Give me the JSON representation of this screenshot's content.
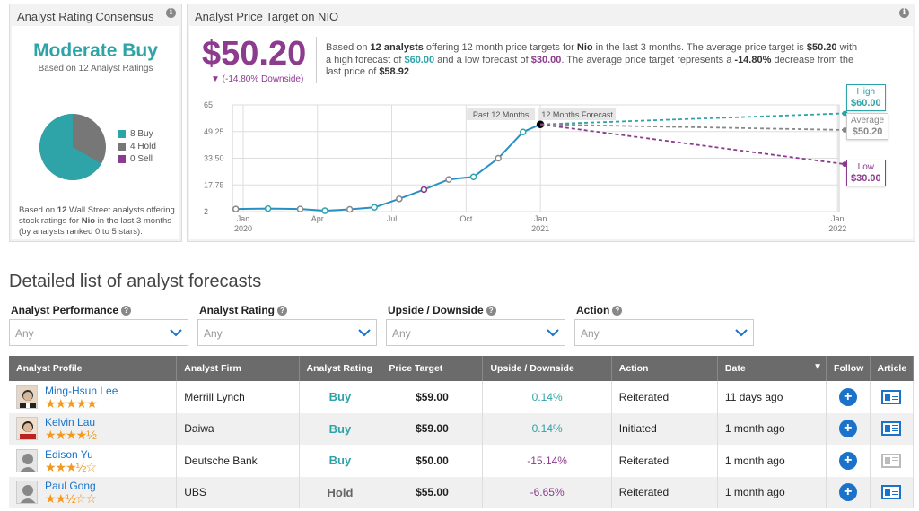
{
  "consensus": {
    "panel_title": "Analyst Rating Consensus",
    "rating": "Moderate Buy",
    "subtitle": "Based on 12 Analyst Ratings",
    "legend": [
      {
        "label": "8 Buy",
        "color": "#2ea3a8",
        "count": 8
      },
      {
        "label": "4 Hold",
        "color": "#777777",
        "count": 4
      },
      {
        "label": "0 Sell",
        "color": "#8c3b8e",
        "count": 0
      }
    ],
    "footer_pre": "Based on ",
    "footer_count": "12",
    "footer_mid": " Wall Street analysts offering stock ratings for ",
    "footer_ticker": "Nio",
    "footer_post": " in the last 3 months (by analysts ranked 0 to 5 stars)."
  },
  "price_target": {
    "panel_title": "Analyst Price Target on NIO",
    "price": "$50.20",
    "downside": "▼ (-14.80% Downside)",
    "desc": {
      "p1": "Based on ",
      "analysts": "12 analysts",
      "p2": " offering 12 month price targets for ",
      "ticker": "Nio",
      "p3": " in the last 3 months. The average price target is ",
      "avg": "$50.20",
      "p4": " with a high forecast of ",
      "high": "$60.00",
      "p5": " and a low forecast of ",
      "low": "$30.00",
      "p6": ". The average price target represents a ",
      "pct": "-14.80%",
      "p7": " decrease from the last price of ",
      "last": "$58.92"
    },
    "tags": {
      "high_label": "High",
      "high_value": "$60.00",
      "avg_label": "Average",
      "avg_value": "$50.20",
      "low_label": "Low",
      "low_value": "$30.00"
    },
    "past_label": "Past 12 Months",
    "forecast_label": "12 Months Forecast"
  },
  "chart_data": {
    "type": "line",
    "ylim": [
      2,
      65
    ],
    "y_ticks": [
      "65",
      "49.25",
      "33.50",
      "17.75",
      "2"
    ],
    "x_ticks": [
      {
        "label": "Jan",
        "sub": "2020",
        "m": 0
      },
      {
        "label": "Apr",
        "sub": "",
        "m": 3
      },
      {
        "label": "Jul",
        "sub": "",
        "m": 6
      },
      {
        "label": "Oct",
        "sub": "",
        "m": 9
      },
      {
        "label": "Jan",
        "sub": "2021",
        "m": 12
      },
      {
        "label": "Jan",
        "sub": "2022",
        "m": 24
      }
    ],
    "series": [
      {
        "m": [
          -0.3,
          1,
          2.3,
          3.3,
          4.3,
          5.3,
          6.3,
          7.3,
          8.3,
          9.3,
          10.3,
          11.3,
          12
        ],
        "values": [
          3.5,
          3.8,
          3.5,
          2.5,
          3.3,
          4.5,
          9.5,
          15,
          21,
          22.5,
          33.5,
          49,
          53.5
        ]
      }
    ],
    "forecast": {
      "start": 53.5,
      "high": 60.0,
      "avg": 50.2,
      "low": 30.0,
      "colors": {
        "high": "#2ea3a8",
        "avg": "#888888",
        "low": "#8c3b8e"
      }
    }
  },
  "list": {
    "title": "Detailed list of analyst forecasts",
    "filters": [
      {
        "label": "Analyst Performance",
        "value": "Any"
      },
      {
        "label": "Analyst Rating",
        "value": "Any"
      },
      {
        "label": "Upside / Downside",
        "value": "Any"
      },
      {
        "label": "Action",
        "value": "Any"
      }
    ],
    "columns": [
      "Analyst Profile",
      "Analyst Firm",
      "Analyst Rating",
      "Price Target",
      "Upside / Downside",
      "Action",
      "Date",
      "Follow",
      "Article"
    ],
    "rows": [
      {
        "name": "Ming-Hsun Lee",
        "stars": "★★★★★",
        "firm": "Merrill Lynch",
        "rating": "Buy",
        "target": "$59.00",
        "pct": "0.14%",
        "action": "Reiterated",
        "date": "11 days ago"
      },
      {
        "name": "Kelvin Lau",
        "stars": "★★★★½",
        "firm": "Daiwa",
        "rating": "Buy",
        "target": "$59.00",
        "pct": "0.14%",
        "action": "Initiated",
        "date": "1 month ago"
      },
      {
        "name": "Edison Yu",
        "stars": "★★★½☆",
        "firm": "Deutsche Bank",
        "rating": "Buy",
        "target": "$50.00",
        "pct": "-15.14%",
        "action": "Reiterated",
        "date": "1 month ago"
      },
      {
        "name": "Paul Gong",
        "stars": "★★½☆☆",
        "firm": "UBS",
        "rating": "Hold",
        "target": "$55.00",
        "pct": "-6.65%",
        "action": "Reiterated",
        "date": "1 month ago"
      }
    ]
  }
}
